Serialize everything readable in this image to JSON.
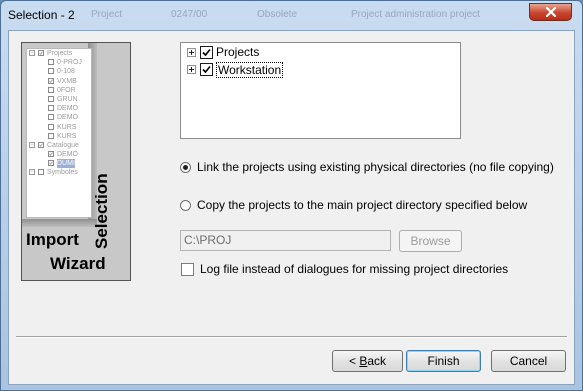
{
  "window": {
    "title": "Selection - 2",
    "ghost_titles": [
      "Project",
      "0247/00",
      "Obsolete",
      "Project administration project"
    ]
  },
  "wizard_image": {
    "import_label": "Import",
    "wizard_label": "Wizard",
    "selection_label": "Selection",
    "mini_tree": [
      {
        "label": "Projects",
        "level": 0,
        "checked": true
      },
      {
        "label": "0-PROJ",
        "level": 1,
        "checked": false
      },
      {
        "label": "0-108",
        "level": 1,
        "checked": false
      },
      {
        "label": "VXMB",
        "level": 1,
        "checked": true
      },
      {
        "label": "0FOR",
        "level": 1,
        "checked": false
      },
      {
        "label": "GRUN",
        "level": 1,
        "checked": false
      },
      {
        "label": "DEMO",
        "level": 1,
        "checked": false
      },
      {
        "label": "DEMO",
        "level": 1,
        "checked": false
      },
      {
        "label": "KURS",
        "level": 1,
        "checked": false
      },
      {
        "label": "KURS",
        "level": 1,
        "checked": false
      },
      {
        "label": "Catalogue",
        "level": 0,
        "checked": true
      },
      {
        "label": "DEMO",
        "level": 1,
        "checked": true
      },
      {
        "label": "DUMI",
        "level": 1,
        "checked": true,
        "selected": true
      },
      {
        "label": "Symboles",
        "level": 0,
        "checked": false
      }
    ]
  },
  "tree": {
    "items": [
      {
        "label": "Projects",
        "checked": true
      },
      {
        "label": "Workstation",
        "checked": true
      }
    ]
  },
  "options": {
    "link_label": "Link the projects using existing physical directories (no file copying)",
    "copy_label": "Copy the projects to the main project directory specified below",
    "selected": "link"
  },
  "path": {
    "value": "C:\\PROJ"
  },
  "browse_label": "Browse",
  "log_checkbox": {
    "label": "Log file instead of dialogues for missing project directories",
    "checked": false
  },
  "footer": {
    "back_label": "< Back",
    "finish_label": "Finish",
    "cancel_label": "Cancel"
  },
  "colors": {
    "title_bar": "#b9d1ea",
    "close_button": "#c8462f",
    "window_bg": "#f0f0f0"
  }
}
